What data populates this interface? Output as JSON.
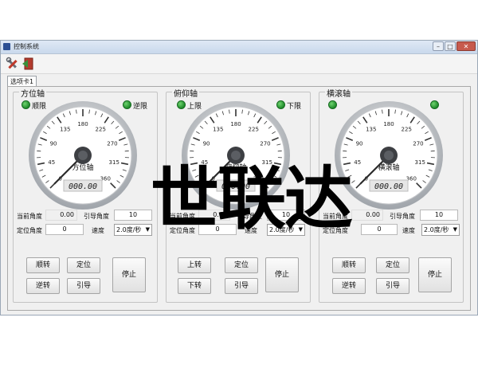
{
  "window": {
    "title": "控制系统",
    "min_icon": "minimize-icon",
    "max_icon": "maximize-icon",
    "close_icon": "close-icon"
  },
  "toolbar": {
    "tools": [
      "tools-icon",
      "exit-icon"
    ]
  },
  "tab": {
    "label": "选项卡1"
  },
  "axes": [
    {
      "title": "方位轴",
      "led_left": "顺限",
      "led_right": "逆限",
      "dial_name": "方位轴",
      "display": "000.00",
      "current_label": "当前角度",
      "current_value": "0.00",
      "guide_label": "引导角度",
      "guide_value": "10",
      "target_label": "定位角度",
      "target_value": "0",
      "speed_label": "速度",
      "speed_value": "2.0度/秒",
      "buttons": [
        "顺转",
        "定位",
        "逆转",
        "引导"
      ],
      "stop": "停止"
    },
    {
      "title": "俯仰轴",
      "led_left": "上限",
      "led_right": "下限",
      "dial_name": "俯仰轴",
      "display": "000.00",
      "current_label": "当前角度",
      "current_value": "0.00",
      "guide_label": "引导角度",
      "guide_value": "10",
      "target_label": "定位角度",
      "target_value": "0",
      "speed_label": "速度",
      "speed_value": "2.0度/秒",
      "buttons": [
        "上转",
        "定位",
        "下转",
        "引导"
      ],
      "stop": "停止"
    },
    {
      "title": "横滚轴",
      "led_left": "",
      "led_right": "",
      "dial_name": "横滚轴",
      "display": "000.00",
      "current_label": "当前角度",
      "current_value": "0.00",
      "guide_label": "引导角度",
      "guide_value": "10",
      "target_label": "定位角度",
      "target_value": "0",
      "speed_label": "速度",
      "speed_value": "2.0度/秒",
      "buttons": [
        "顺转",
        "定位",
        "逆转",
        "引导"
      ],
      "stop": "停止"
    }
  ],
  "gauge": {
    "scale_labels": [
      "0",
      "45",
      "90",
      "135",
      "180",
      "225",
      "270",
      "315",
      "360"
    ],
    "needle_value": 0
  },
  "colors": {
    "led_on": "#2a9d36",
    "titlebar": "#cfdcec"
  },
  "watermark": "世联达"
}
